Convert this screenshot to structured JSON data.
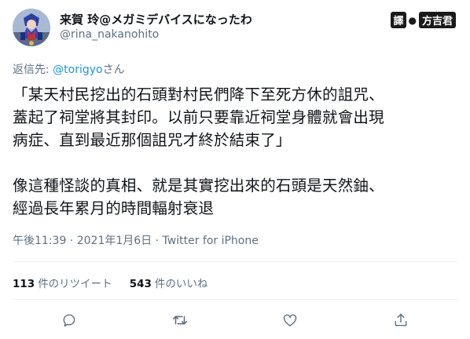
{
  "user": {
    "display_name": "来賀 玲@メガミデバイスになったわ",
    "handle": "@rina_nakanohito"
  },
  "watermark": {
    "translate_char": "譯",
    "name": "方吉君"
  },
  "reply": {
    "prefix": "返信先: ",
    "mention": "@torigyo",
    "suffix": "さん"
  },
  "tweet": {
    "text": "「某天村民挖出的石頭對村民們降下至死方休的詛咒、\n蓋起了祠堂將其封印。以前只要靠近祠堂身體就會出現\n病症、直到最近那個詛咒才終於結束了」\n\n像這種怪談的真相、就是其實挖出來的石頭是天然鈾、\n經過長年累月的時間輻射衰退"
  },
  "meta": {
    "time": "午後11:39",
    "separator": " · ",
    "date": "2021年1月6日",
    "source": "Twitter for iPhone"
  },
  "stats": {
    "retweet_count": "113",
    "retweet_label": "件のリツイート",
    "like_count": "543",
    "like_label": "件のいいね"
  },
  "icons": {
    "reply": "reply-icon",
    "retweet": "retweet-icon",
    "like": "heart-icon",
    "share": "share-icon"
  },
  "colors": {
    "text": "#0f1419",
    "secondary": "#5b7083",
    "link": "#1b95e0",
    "divider": "#ebeef0"
  }
}
